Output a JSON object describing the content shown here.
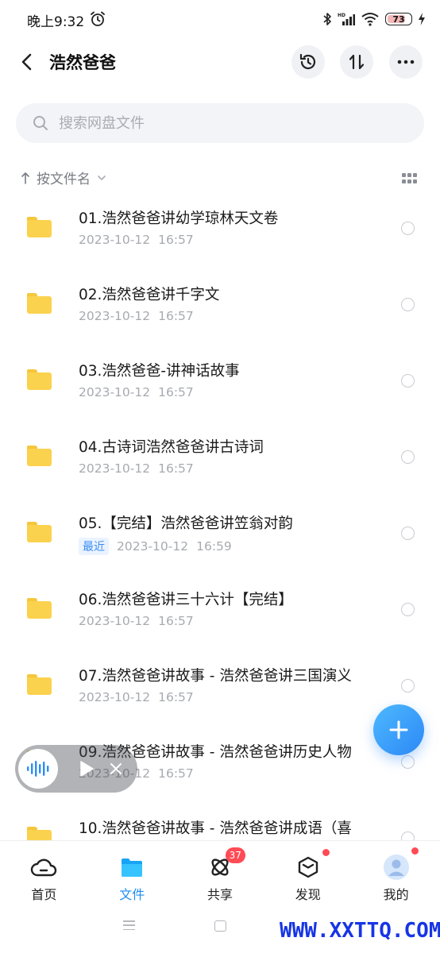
{
  "status_bar": {
    "time": "晚上9:32",
    "battery": "73",
    "icons": [
      "alarm-icon",
      "bluetooth-icon",
      "signal-icon",
      "wifi-icon",
      "battery-icon",
      "charging-icon"
    ]
  },
  "header": {
    "title": "浩然爸爸",
    "icons": [
      "back-icon",
      "history-icon",
      "sort-toggle-icon",
      "more-icon"
    ]
  },
  "search": {
    "placeholder": "搜索网盘文件"
  },
  "sort": {
    "label": "按文件名"
  },
  "files": [
    {
      "name": "01.浩然爸爸讲幼学琼林天文卷",
      "date": "2023-10-12",
      "time": "16:57",
      "tag": ""
    },
    {
      "name": "02.浩然爸爸讲千字文",
      "date": "2023-10-12",
      "time": "16:57",
      "tag": ""
    },
    {
      "name": "03.浩然爸爸-讲神话故事",
      "date": "2023-10-12",
      "time": "16:57",
      "tag": ""
    },
    {
      "name": "04.古诗词浩然爸爸讲古诗词",
      "date": "2023-10-12",
      "time": "16:57",
      "tag": ""
    },
    {
      "name": "05.【完结】浩然爸爸讲笠翁对韵",
      "date": "2023-10-12",
      "time": "16:59",
      "tag": "最近"
    },
    {
      "name": "06.浩然爸爸讲三十六计【完结】",
      "date": "2023-10-12",
      "time": "16:57",
      "tag": ""
    },
    {
      "name": "07.浩然爸爸讲故事 - 浩然爸爸讲三国演义",
      "date": "2023-10-12",
      "time": "16:57",
      "tag": ""
    },
    {
      "name": "09.浩然爸爸讲故事 - 浩然爸爸讲历史人物",
      "date": "2023-10-12",
      "time": "16:57",
      "tag": ""
    },
    {
      "name": "10.浩然爸爸讲故事 - 浩然爸爸讲成语（喜",
      "date": "",
      "time": "",
      "tag": ""
    }
  ],
  "bottom_nav": [
    {
      "label": "首页",
      "icon": "cloud-icon",
      "active": false
    },
    {
      "label": "文件",
      "icon": "folder-icon",
      "active": true
    },
    {
      "label": "共享",
      "icon": "atom-icon",
      "active": false,
      "badge": "37"
    },
    {
      "label": "发现",
      "icon": "cube-icon",
      "active": false
    },
    {
      "label": "我的",
      "icon": "avatar-icon",
      "active": false
    }
  ],
  "watermark": "WWW.XXTTQ.COM",
  "colors": {
    "accent": "#1e8cf5",
    "folder": "#fbd24e",
    "badge": "#ff4b55"
  }
}
